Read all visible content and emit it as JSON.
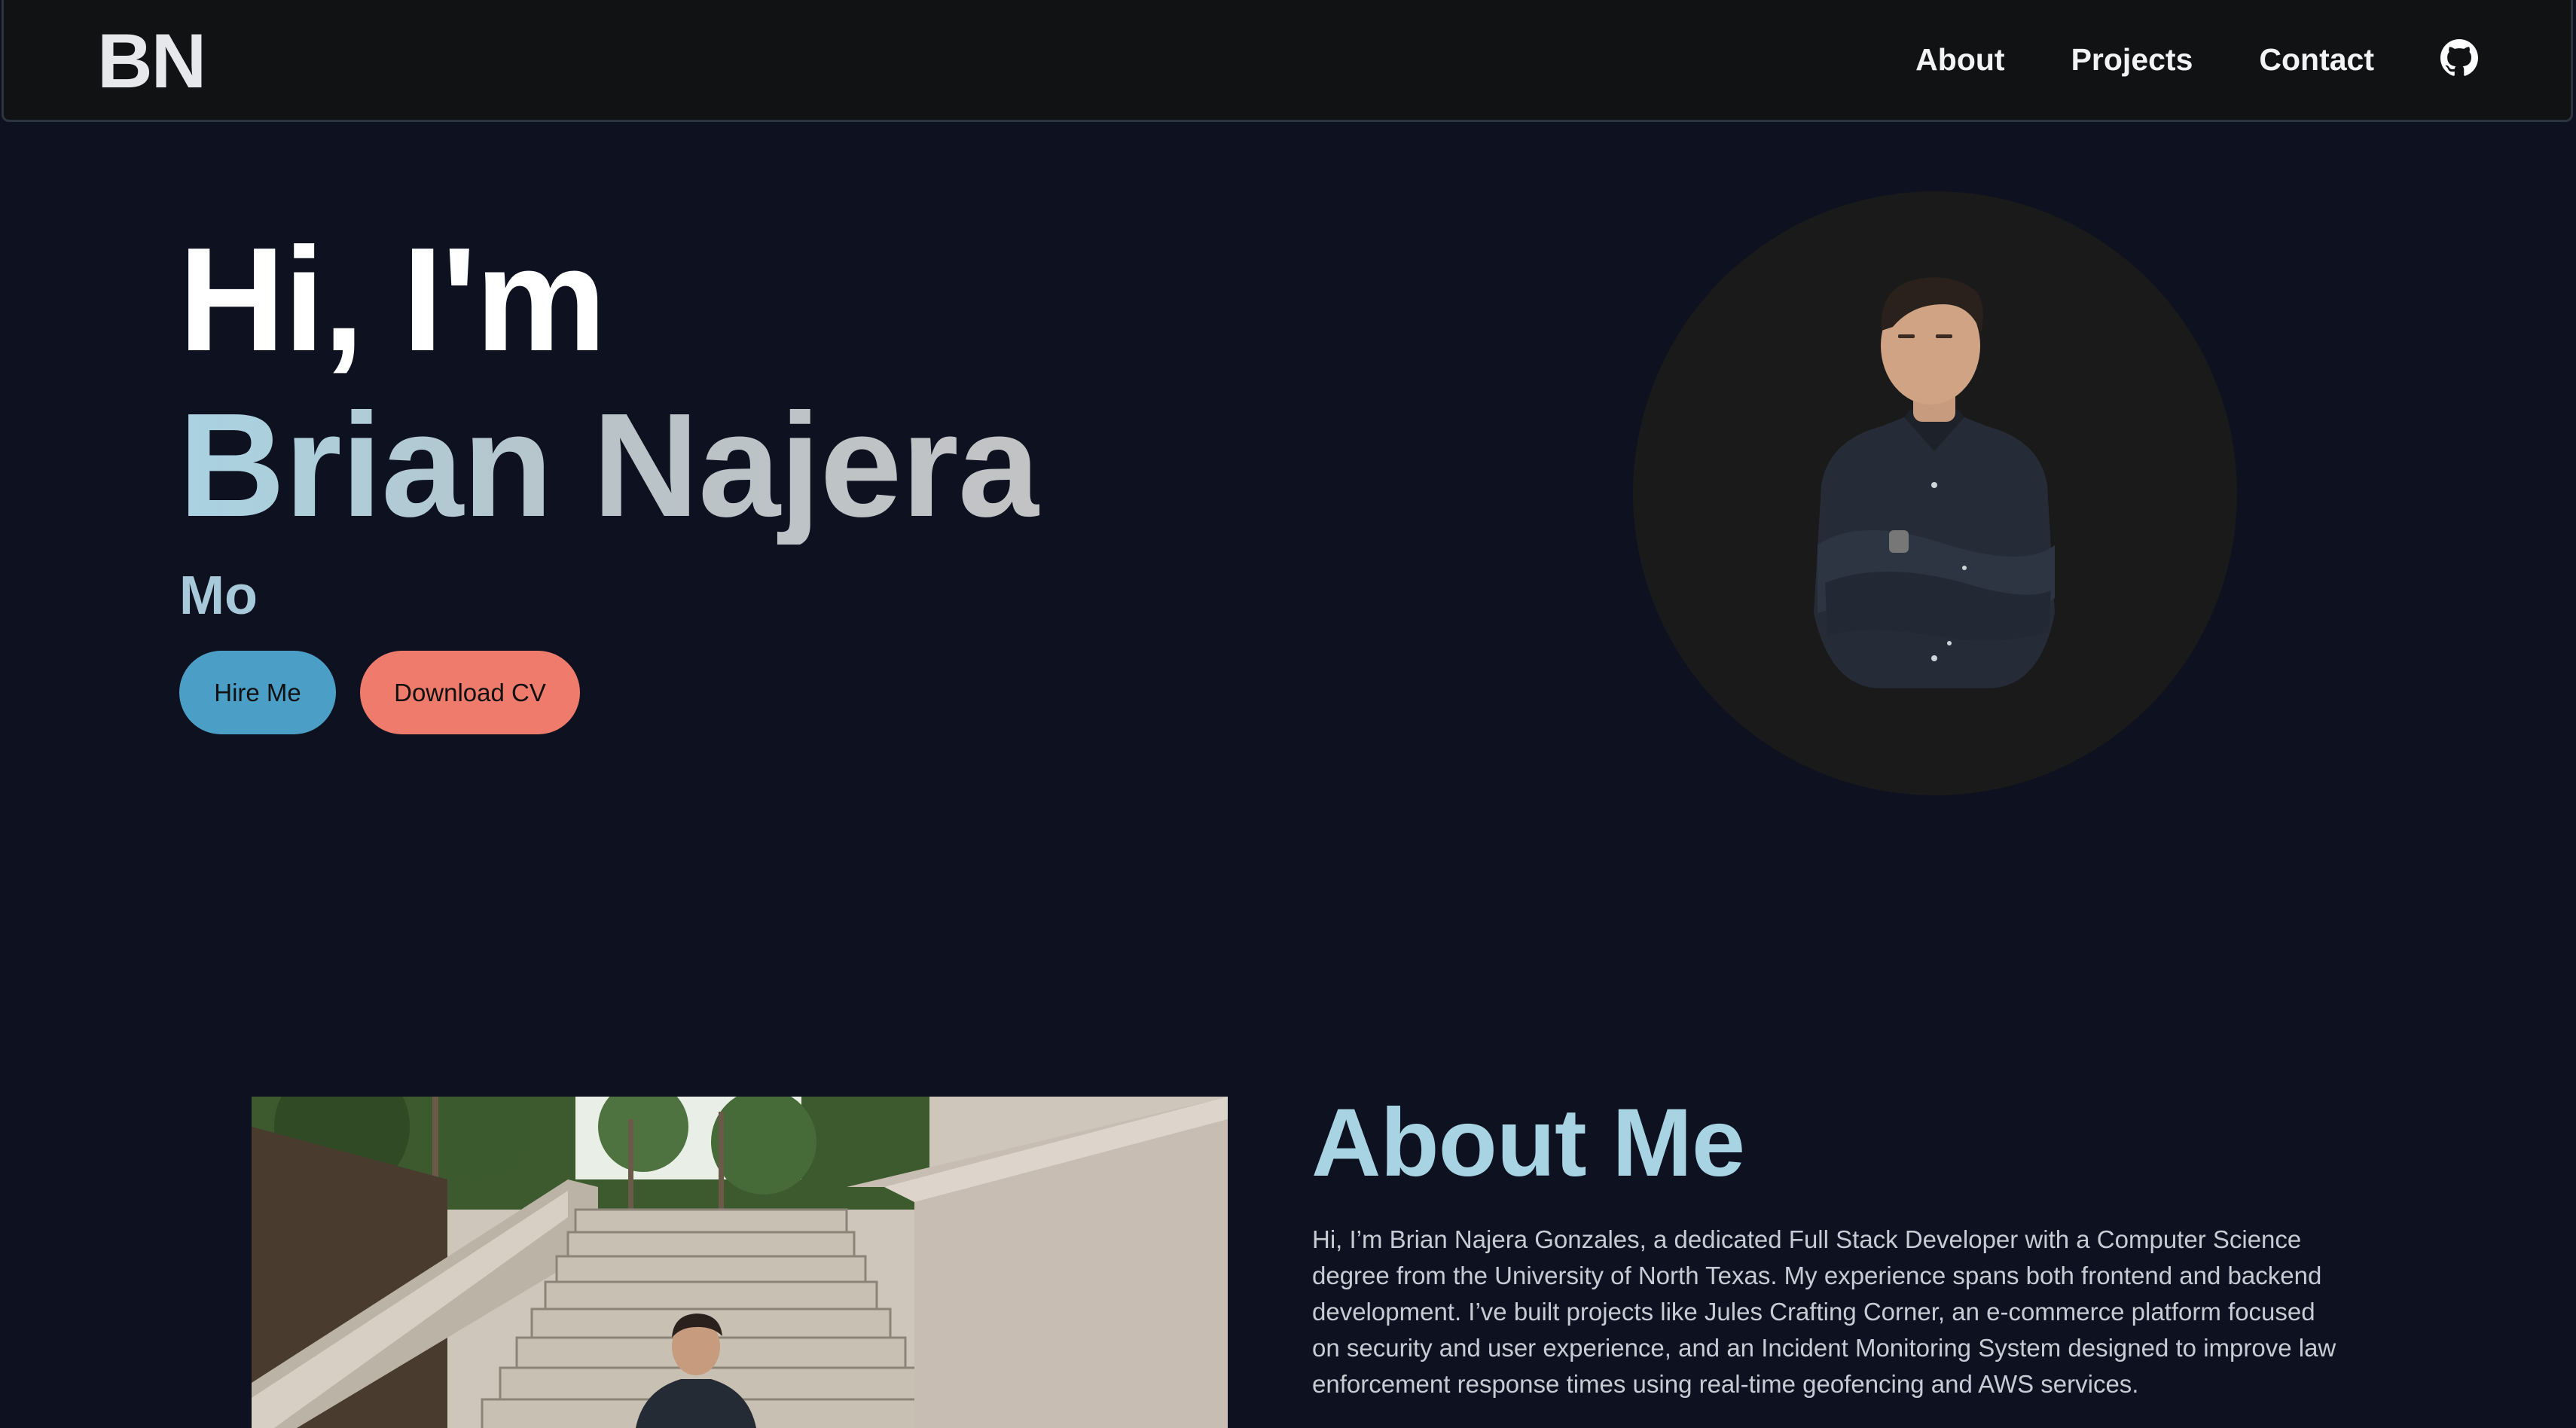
{
  "nav": {
    "logo": "BN",
    "links": [
      "About",
      "Projects",
      "Contact"
    ],
    "github_icon": "github-icon"
  },
  "hero": {
    "greeting": "Hi, I'm",
    "name": "Brian Najera",
    "typing_text": "Mo",
    "hire_button": "Hire Me",
    "cv_button": "Download CV",
    "name_gradient": [
      "#a9d2e2",
      "#c3c3c5"
    ]
  },
  "about": {
    "title": "About Me",
    "paragraph1": "Hi, I’m Brian Najera Gonzales, a dedicated Full Stack Developer with a Computer Science degree from the University of North Texas. My experience spans both frontend and backend development. I’ve built projects like Jules Crafting Corner, an e-commerce platform focused on security and user experience, and an Incident Monitoring System designed to improve law enforcement response times using real-time geofencing and AWS services."
  },
  "colors": {
    "background": "#0d1120",
    "navbar": "#111214",
    "hire_button": "#4b9ec6",
    "cv_button": "#ee7b6b",
    "accent": "#a8d3e3"
  }
}
